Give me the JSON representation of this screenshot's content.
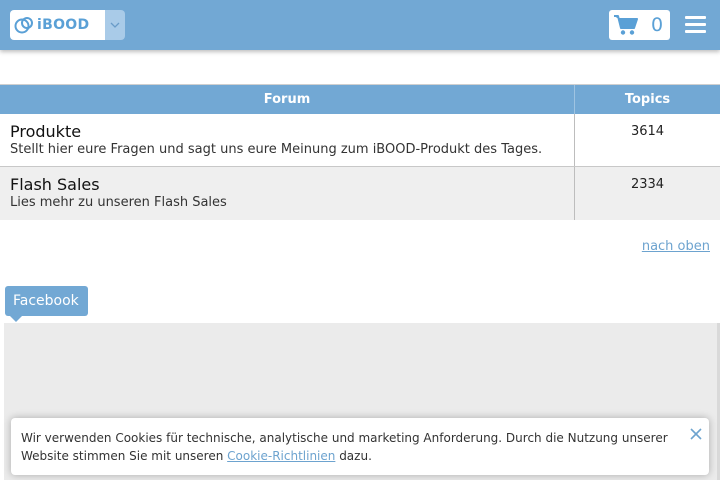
{
  "header": {
    "logo_text": "iBOOD",
    "cart_count": "0",
    "accent_color": "#72a8d4"
  },
  "forum_table": {
    "columns": [
      "Forum",
      "Topics"
    ],
    "rows": [
      {
        "title": "Produkte",
        "description": "Stellt hier eure Fragen und sagt uns eure Meinung zum iBOOD-Produkt des Tages.",
        "topics": "3614"
      },
      {
        "title": "Flash Sales",
        "description": "Lies mehr zu unseren Flash Sales",
        "topics": "2334"
      }
    ]
  },
  "to_top_link": "nach oben",
  "facebook_tab": "Facebook",
  "cookie_banner": {
    "text_before": "Wir verwenden Cookies für technische, analytische und marketing Anforderung. Durch die Nutzung unserer Website stimmen Sie mit unseren ",
    "link_text": "Cookie-Richtlinien",
    "text_after": " dazu."
  },
  "icons": [
    "ibood-logo-icon",
    "chevron-down-icon",
    "cart-icon",
    "hamburger-menu-icon",
    "close-icon"
  ]
}
